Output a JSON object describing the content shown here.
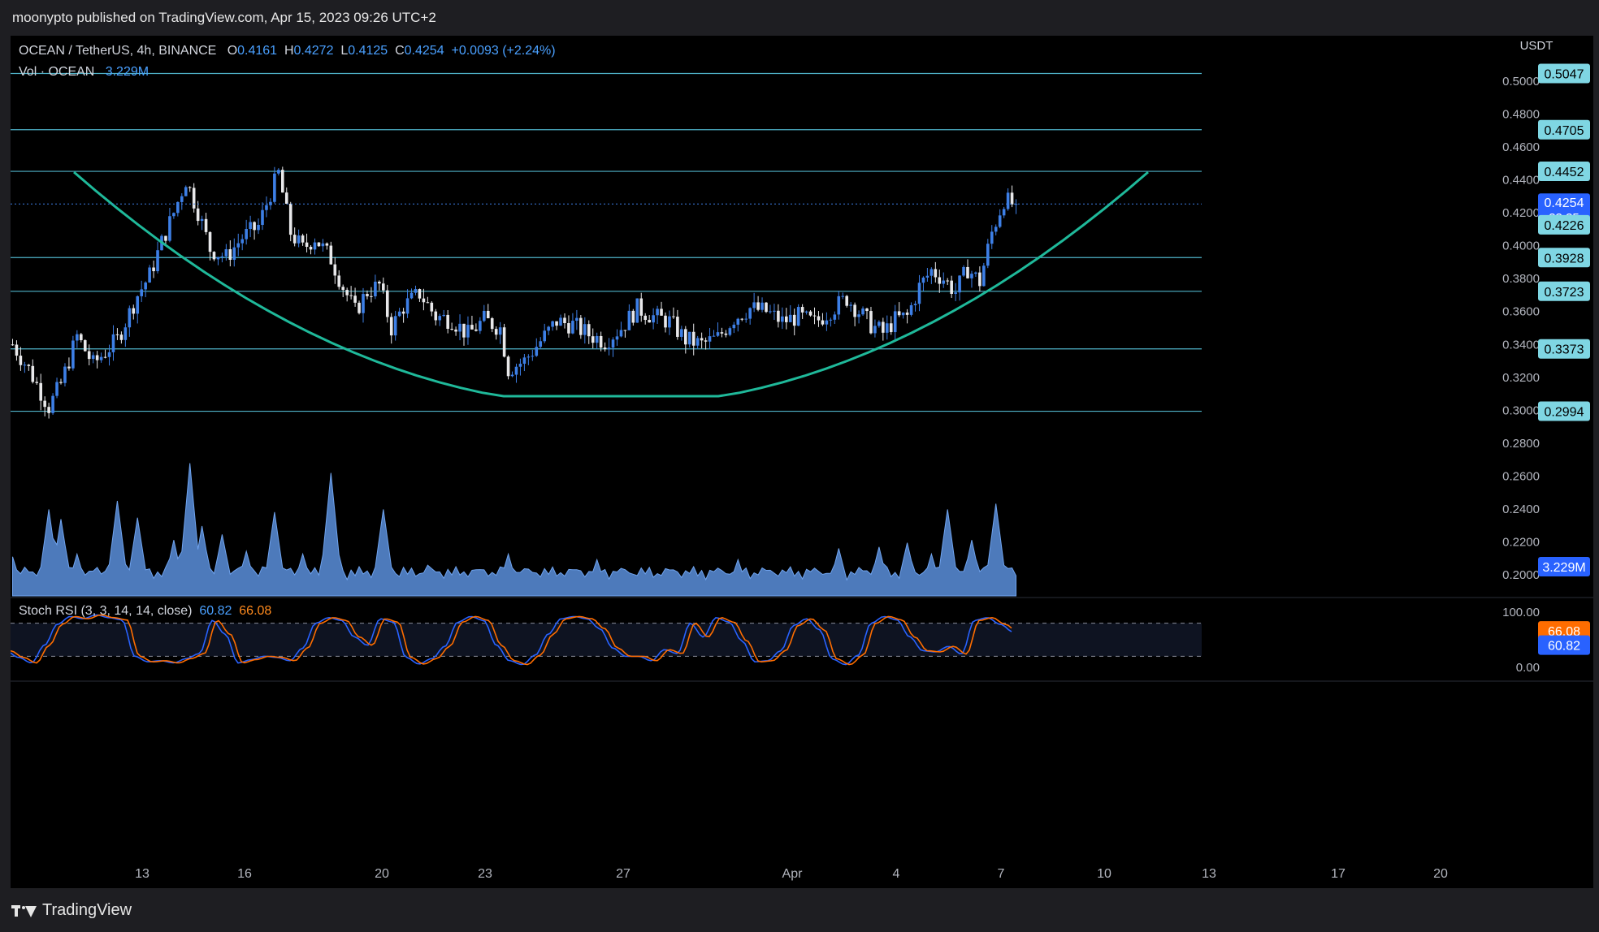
{
  "header": {
    "publisher": "moonypto published on TradingView.com, Apr 15, 2023 09:26 UTC+2"
  },
  "legend": {
    "symbol": "OCEAN / TetherUS, 4h, BINANCE",
    "o_label": "O",
    "open": "0.4161",
    "h_label": "H",
    "high": "0.4272",
    "l_label": "L",
    "low": "0.4125",
    "c_label": "C",
    "close": "0.4254",
    "change": "+0.0093 (+2.24%)",
    "vol_label": "Vol · OCEAN",
    "vol_value": "3.229M",
    "stoch_label": "Stoch RSI (3, 3, 14, 14, close)",
    "stoch_k": "60.82",
    "stoch_d": "66.08"
  },
  "footer": {
    "brand": "TradingView"
  },
  "colors": {
    "background": "#000000",
    "up": "#3d7fe6",
    "down": "#e8e8ea",
    "hline": "#4fb3c9",
    "arc": "#1fb99a",
    "volume": "#5b8fdc",
    "k_line": "#2962ff",
    "d_line": "#ff6d00"
  },
  "chart_data": {
    "type": "candlestick",
    "currency": "USDT",
    "timeframe": "4h",
    "x_tick_labels": [
      "13",
      "16",
      "20",
      "23",
      "27",
      "Apr",
      "4",
      "7",
      "10",
      "13",
      "17",
      "20"
    ],
    "y_ticks": [
      "0.5000",
      "0.4800",
      "0.4600",
      "0.4400",
      "0.4200",
      "0.4000",
      "0.3800",
      "0.3600",
      "0.3400",
      "0.3200",
      "0.3000",
      "0.2800",
      "0.2600",
      "0.2400",
      "0.2200",
      "0.2000"
    ],
    "horizontal_levels": [
      0.5047,
      0.4705,
      0.4452,
      0.3928,
      0.3723,
      0.3373,
      0.2994
    ],
    "current_price": {
      "price": "0.4254",
      "countdown": "33:35"
    },
    "current_price_secondary": "0.4226",
    "volume_label": "3.229M",
    "stoch_axis": [
      "100.00",
      "0.00"
    ],
    "stoch_levels": [
      80,
      20
    ],
    "stoch_last": {
      "d": "66.08",
      "k": "60.82"
    },
    "anchors": [
      [
        0,
        0.34
      ],
      [
        4,
        0.325
      ],
      [
        9,
        0.302
      ],
      [
        12,
        0.316
      ],
      [
        16,
        0.345
      ],
      [
        20,
        0.328
      ],
      [
        26,
        0.343
      ],
      [
        31,
        0.37
      ],
      [
        34,
        0.382
      ],
      [
        37,
        0.402
      ],
      [
        40,
        0.42
      ],
      [
        43,
        0.44
      ],
      [
        46,
        0.421
      ],
      [
        49,
        0.398
      ],
      [
        53,
        0.393
      ],
      [
        57,
        0.405
      ],
      [
        61,
        0.412
      ],
      [
        64,
        0.432
      ],
      [
        66,
        0.444
      ],
      [
        69,
        0.408
      ],
      [
        72,
        0.398
      ],
      [
        75,
        0.405
      ],
      [
        79,
        0.392
      ],
      [
        82,
        0.375
      ],
      [
        85,
        0.36
      ],
      [
        88,
        0.372
      ],
      [
        91,
        0.376
      ],
      [
        94,
        0.35
      ],
      [
        97,
        0.363
      ],
      [
        101,
        0.371
      ],
      [
        105,
        0.357
      ],
      [
        109,
        0.355
      ],
      [
        113,
        0.346
      ],
      [
        117,
        0.355
      ],
      [
        121,
        0.35
      ],
      [
        123,
        0.325
      ],
      [
        127,
        0.33
      ],
      [
        131,
        0.342
      ],
      [
        135,
        0.354
      ],
      [
        139,
        0.352
      ],
      [
        143,
        0.346
      ],
      [
        147,
        0.342
      ],
      [
        151,
        0.35
      ],
      [
        155,
        0.362
      ],
      [
        159,
        0.357
      ],
      [
        163,
        0.354
      ],
      [
        167,
        0.343
      ],
      [
        171,
        0.34
      ],
      [
        175,
        0.344
      ],
      [
        179,
        0.356
      ],
      [
        183,
        0.362
      ],
      [
        187,
        0.36
      ],
      [
        191,
        0.354
      ],
      [
        195,
        0.357
      ],
      [
        199,
        0.353
      ],
      [
        203,
        0.361
      ],
      [
        207,
        0.368
      ],
      [
        210,
        0.36
      ],
      [
        213,
        0.352
      ],
      [
        216,
        0.347
      ],
      [
        219,
        0.355
      ],
      [
        222,
        0.357
      ],
      [
        225,
        0.375
      ],
      [
        228,
        0.385
      ],
      [
        231,
        0.38
      ],
      [
        234,
        0.372
      ],
      [
        237,
        0.386
      ],
      [
        240,
        0.378
      ],
      [
        243,
        0.408
      ],
      [
        246,
        0.428
      ],
      [
        248,
        0.4254
      ]
    ],
    "volume_spikes": [
      [
        0,
        0.28
      ],
      [
        9,
        0.62
      ],
      [
        12,
        0.55
      ],
      [
        16,
        0.3
      ],
      [
        26,
        0.68
      ],
      [
        31,
        0.56
      ],
      [
        40,
        0.4
      ],
      [
        44,
        0.95
      ],
      [
        47,
        0.5
      ],
      [
        52,
        0.44
      ],
      [
        58,
        0.32
      ],
      [
        65,
        0.6
      ],
      [
        72,
        0.3
      ],
      [
        79,
        0.88
      ],
      [
        92,
        0.62
      ],
      [
        103,
        0.22
      ],
      [
        123,
        0.3
      ],
      [
        145,
        0.26
      ],
      [
        180,
        0.26
      ],
      [
        205,
        0.34
      ],
      [
        215,
        0.35
      ],
      [
        222,
        0.38
      ],
      [
        228,
        0.3
      ],
      [
        232,
        0.62
      ],
      [
        238,
        0.4
      ],
      [
        244,
        0.66
      ],
      [
        248,
        0.2
      ]
    ],
    "stoch_pattern": [
      30,
      18,
      8,
      40,
      78,
      92,
      88,
      95,
      90,
      86,
      20,
      10,
      12,
      8,
      16,
      25,
      85,
      60,
      8,
      14,
      20,
      18,
      12,
      35,
      80,
      90,
      85,
      55,
      40,
      88,
      82,
      18,
      6,
      16,
      38,
      82,
      92,
      85,
      40,
      12,
      5,
      22,
      60,
      88,
      92,
      88,
      70,
      35,
      20,
      20,
      12,
      32,
      25,
      80,
      55,
      90,
      82,
      48,
      10,
      12,
      30,
      76,
      88,
      68,
      15,
      5,
      22,
      80,
      92,
      86,
      55,
      30,
      28,
      38,
      24,
      85,
      90,
      78,
      64
    ]
  }
}
